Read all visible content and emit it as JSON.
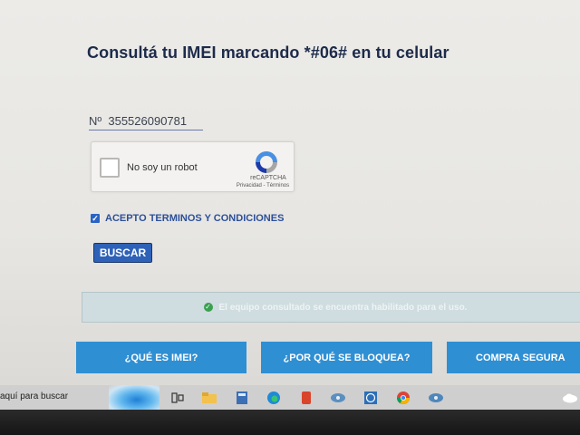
{
  "page": {
    "title": "Consultá tu IMEI marcando *#06# en tu celular"
  },
  "imei": {
    "value": "Nº  355526090781"
  },
  "recaptcha": {
    "label": "No soy un robot",
    "brand": "reCAPTCHA",
    "links": "Privacidad - Términos"
  },
  "terms": {
    "label": "ACEPTO TERMINOS Y CONDICIONES",
    "checked": true
  },
  "search_button": {
    "label": "BUSCAR"
  },
  "alert": {
    "text": "El equipo consultado se encuentra habilitado para el uso."
  },
  "nav": {
    "imei_label": "¿QUÉ ES IMEI?",
    "bloquea_label": "¿POR QUÉ SE BLOQUEA?",
    "compra_label": "COMPRA SEGURA"
  },
  "taskbar": {
    "search_text": "aquí para buscar",
    "icons": [
      "task-view-icon",
      "file-explorer-icon",
      "calculator-icon",
      "edge-icon",
      "office-icon",
      "app-icon",
      "clock-icon",
      "chrome-icon",
      "app-icon-2",
      "network-icon"
    ]
  },
  "colors": {
    "title": "#1d2b4a",
    "link_blue": "#2c4f9a",
    "button_blue": "#2e62b8",
    "nav_blue": "#2f8fd3",
    "alert_bg": "#cfdde0",
    "success_green": "#3aa04f"
  }
}
